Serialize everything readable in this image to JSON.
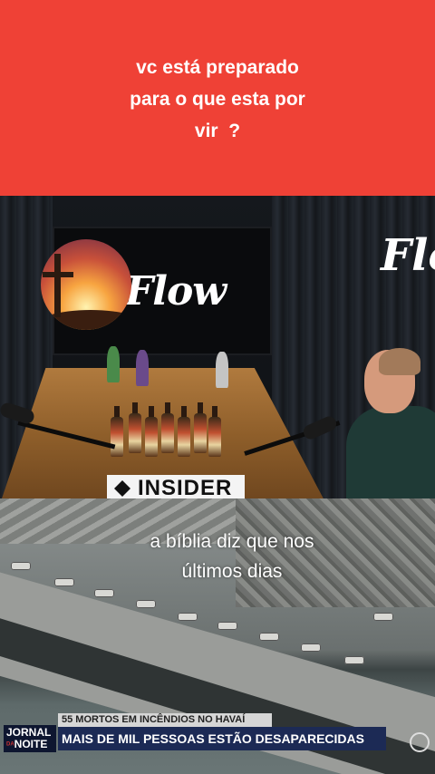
{
  "top_caption": {
    "line1": "vc está preparado",
    "line2": "para o que esta por",
    "line3": "vir  ?"
  },
  "studio": {
    "flow_logo": "Flow",
    "flow_logo_right": "Flo",
    "insider_sign": "INSIDER"
  },
  "mid_caption": {
    "line1": "a bíblia diz que nos",
    "line2": "últimos dias"
  },
  "news": {
    "logo_line1": "JORNAL",
    "logo_small": "DA",
    "logo_line2": "NOITE",
    "headline_top": "55 MORTOS EM INCÊNDIOS NO HAVAÍ",
    "headline_main": "MAIS DE MIL PESSOAS ESTÃO DESAPARECIDAS"
  },
  "colors": {
    "caption_band": "#ef4136",
    "chyron_main": "#1c2a55",
    "chyron_top": "#d6d6d6"
  }
}
